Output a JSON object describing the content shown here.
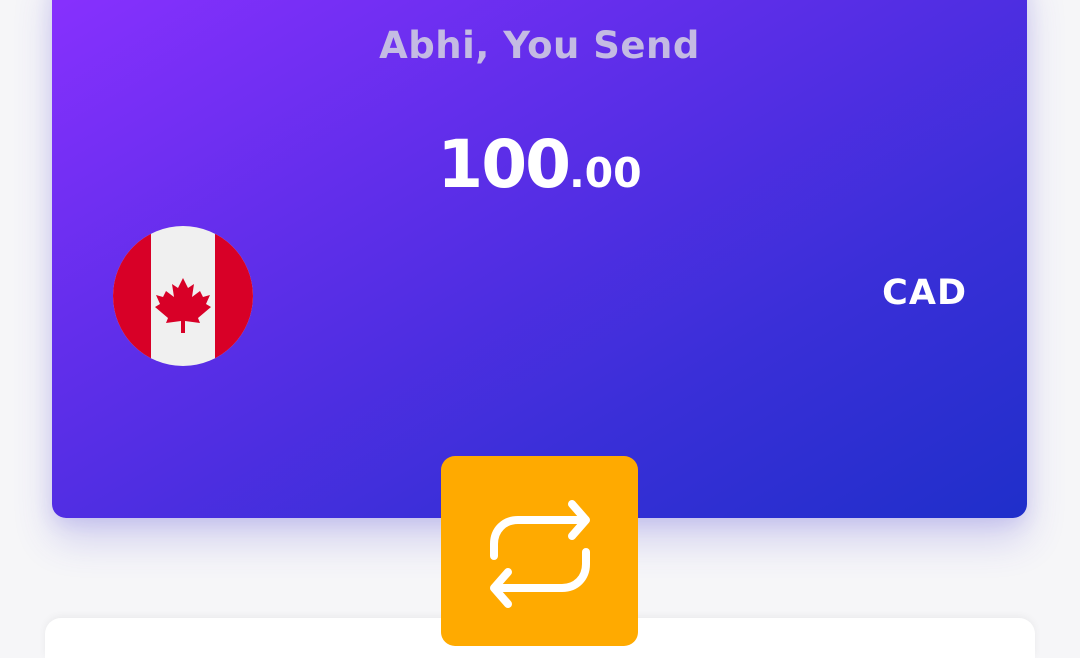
{
  "send_card": {
    "title": "Abhi, You Send",
    "amount_integer": "100",
    "amount_decimal": ".00",
    "currency_code": "CAD",
    "flag_icon": "canada-flag-icon"
  },
  "swap_button": {
    "icon": "swap-icon",
    "color": "#ffaa00"
  },
  "colors": {
    "card_gradient_start": "#8a30ff",
    "card_gradient_end": "#1f2fca",
    "title_text": "#c4bbe3",
    "amount_text": "#ffffff",
    "flag_red": "#d80027",
    "flag_white": "#f0f0f0"
  }
}
